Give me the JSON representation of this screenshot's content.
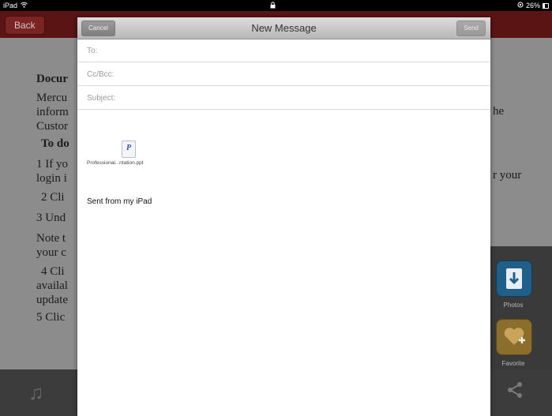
{
  "status_bar": {
    "device": "iPad",
    "battery": "26%",
    "wifi_icon": "wifi-icon",
    "lock_icon": "lock-icon"
  },
  "background_app": {
    "back_label": "Back",
    "doc_lines": [
      {
        "text": "Docur",
        "bold": true
      },
      {
        "text": "Mercu",
        "bold": false
      },
      {
        "text": "inform",
        "bold": false
      },
      {
        "text": "Custor",
        "bold": false
      },
      {
        "text": "To do",
        "bold": true
      },
      {
        "text": "1 If yo",
        "bold": false
      },
      {
        "text": "login i",
        "bold": false
      },
      {
        "text": "2 Cli",
        "bold": false
      },
      {
        "text": "3 Und",
        "bold": false
      },
      {
        "text": "Note t",
        "bold": false
      },
      {
        "text": "your c",
        "bold": false
      },
      {
        "text": "4 Cli",
        "bold": false
      },
      {
        "text": "availal",
        "bold": false
      },
      {
        "text": "update",
        "bold": false
      },
      {
        "text": "5 Clic",
        "bold": false
      }
    ],
    "right_fragments": [
      "he",
      "r your"
    ],
    "side_panel": {
      "photos_label": "Photos",
      "favorite_label": "Favorite"
    }
  },
  "composer": {
    "title": "New Message",
    "cancel_label": "Cancel",
    "send_label": "Send",
    "to_label": "To:",
    "to_value": "",
    "cc_label": "Cc/Bcc:",
    "cc_value": "",
    "subject_label": "Subject:",
    "subject_value": "",
    "attachment_name": "Professional...ntation.ppt",
    "attachment_icon_letter": "P",
    "signature": "Sent from my iPad"
  },
  "colors": {
    "navbar_dark_red": "#5a1414",
    "sheet_white": "#ffffff",
    "composer_bar": "#c9c9c9"
  }
}
